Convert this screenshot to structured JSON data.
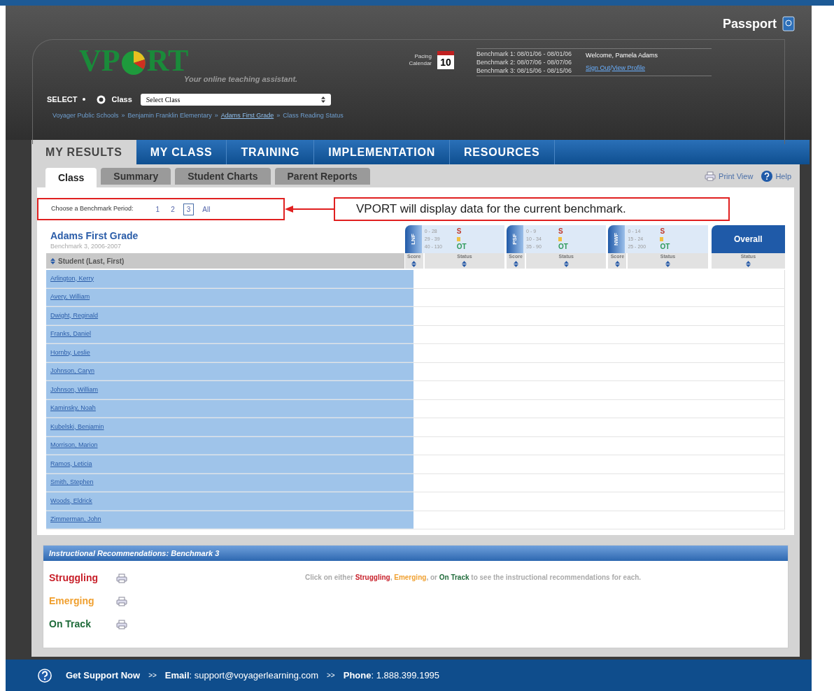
{
  "brand": {
    "title": "Passport"
  },
  "logo": {
    "before": "VP",
    "after": "RT",
    "tagline": "Your online teaching assistant."
  },
  "pacing_calendar": {
    "label": "Pacing Calendar",
    "day": "10"
  },
  "benchmarks": [
    "Benchmark 1: 08/01/06 - 08/01/06",
    "Benchmark 2: 08/07/06 - 08/07/06",
    "Benchmark 3: 08/15/06 - 08/15/06"
  ],
  "user": {
    "welcome": "Welcome, Pamela Adams",
    "links": [
      "Sign Out",
      "View Profile"
    ],
    "separator": "/"
  },
  "select": {
    "label": "SELECT",
    "option": "Class",
    "dropdown_value": "Select Class"
  },
  "breadcrumb": {
    "separator": "»",
    "items": [
      {
        "label": "Voyager Public Schools",
        "current": false
      },
      {
        "label": "Benjamin Franklin Elementary",
        "current": false
      },
      {
        "label": "Adams First Grade",
        "current": true
      },
      {
        "label": "Class Reading Status",
        "current": false
      }
    ]
  },
  "nav_tabs": [
    {
      "label": "MY RESULTS",
      "selected": true
    },
    {
      "label": "MY CLASS",
      "selected": false
    },
    {
      "label": "TRAINING",
      "selected": false
    },
    {
      "label": "IMPLEMENTATION",
      "selected": false
    },
    {
      "label": "RESOURCES",
      "selected": false
    }
  ],
  "sub_tabs": [
    {
      "label": "Class",
      "selected": true
    },
    {
      "label": "Summary",
      "selected": false
    },
    {
      "label": "Student Charts",
      "selected": false
    },
    {
      "label": "Parent Reports",
      "selected": false
    }
  ],
  "tools": [
    "Print View",
    "Help"
  ],
  "benchmark_period": {
    "label": "Choose a Benchmark Period:",
    "options": [
      {
        "label": "1",
        "selected": false
      },
      {
        "label": "2",
        "selected": false
      },
      {
        "label": "3",
        "selected": true
      },
      {
        "label": "All",
        "selected": false
      }
    ]
  },
  "annotation": "VPORT will display data for the current benchmark.",
  "class_info": {
    "name": "Adams First Grade",
    "subtitle": "Benchmark 3, 2006-2007"
  },
  "table": {
    "student_column": "Student (Last, First)",
    "measures": [
      {
        "name": "LNF",
        "ranges": [
          {
            "range": "0 - 28",
            "status": "S",
            "color": "#c0392b"
          },
          {
            "range": "29 - 39",
            "color": "#f0c040"
          },
          {
            "range": "40 - 110",
            "status": "OT",
            "color": "#2e9a5a"
          }
        ]
      },
      {
        "name": "PSF",
        "ranges": [
          {
            "range": "0 - 9",
            "status": "S",
            "color": "#c0392b"
          },
          {
            "range": "10 - 34",
            "color": "#f0c040"
          },
          {
            "range": "35 - 90",
            "status": "OT",
            "color": "#2e9a5a"
          }
        ]
      },
      {
        "name": "NWF",
        "ranges": [
          {
            "range": "0 - 14",
            "status": "S",
            "color": "#c0392b"
          },
          {
            "range": "15 - 24",
            "color": "#f0c040"
          },
          {
            "range": "25 - 200",
            "status": "OT",
            "color": "#2e9a5a"
          }
        ]
      }
    ],
    "score_labels": [
      "Score",
      "Score",
      "Score"
    ],
    "status_labels": [
      "Status",
      "Status",
      "Status"
    ],
    "overall_label": "Overall",
    "overall_status_label": "Status",
    "students": [
      "Arlington, Kerry",
      "Avery, William",
      "Dwight, Reginald",
      "Franks, Daniel",
      "Hornby, Leslie",
      "Johnson, Caryn",
      "Johnson, William",
      "Kaminsky, Noah",
      "Kubelski, Benjamin",
      "Morrison, Marion",
      "Ramos, Leticia",
      "Smith, Stephen",
      "Woods, Eldrick",
      "Zimmerman, John"
    ]
  },
  "recommendations": {
    "title": "Instructional Recommendations: Benchmark 3",
    "levels": [
      {
        "label": "Struggling",
        "color": "#c8202a"
      },
      {
        "label": "Emerging",
        "color": "#f0a030"
      },
      {
        "label": "On Track",
        "color": "#1f6b3a"
      }
    ],
    "hint": [
      {
        "text": "Click on either "
      },
      {
        "text": "Struggling",
        "color": "#c8202a"
      },
      {
        "text": ", "
      },
      {
        "text": "Emerging",
        "color": "#f0a030"
      },
      {
        "text": ", or "
      },
      {
        "text": "On Track",
        "color": "#1f6b3a"
      },
      {
        "text": " to see the instructional recommendations for each."
      }
    ]
  },
  "footer": {
    "title": "Get Support Now",
    "separator": ">>",
    "label_separator": ":",
    "items": [
      {
        "label": "Email",
        "value": "support@voyagerlearning.com"
      },
      {
        "label": "Phone",
        "value": "1.888.399.1995"
      }
    ]
  }
}
